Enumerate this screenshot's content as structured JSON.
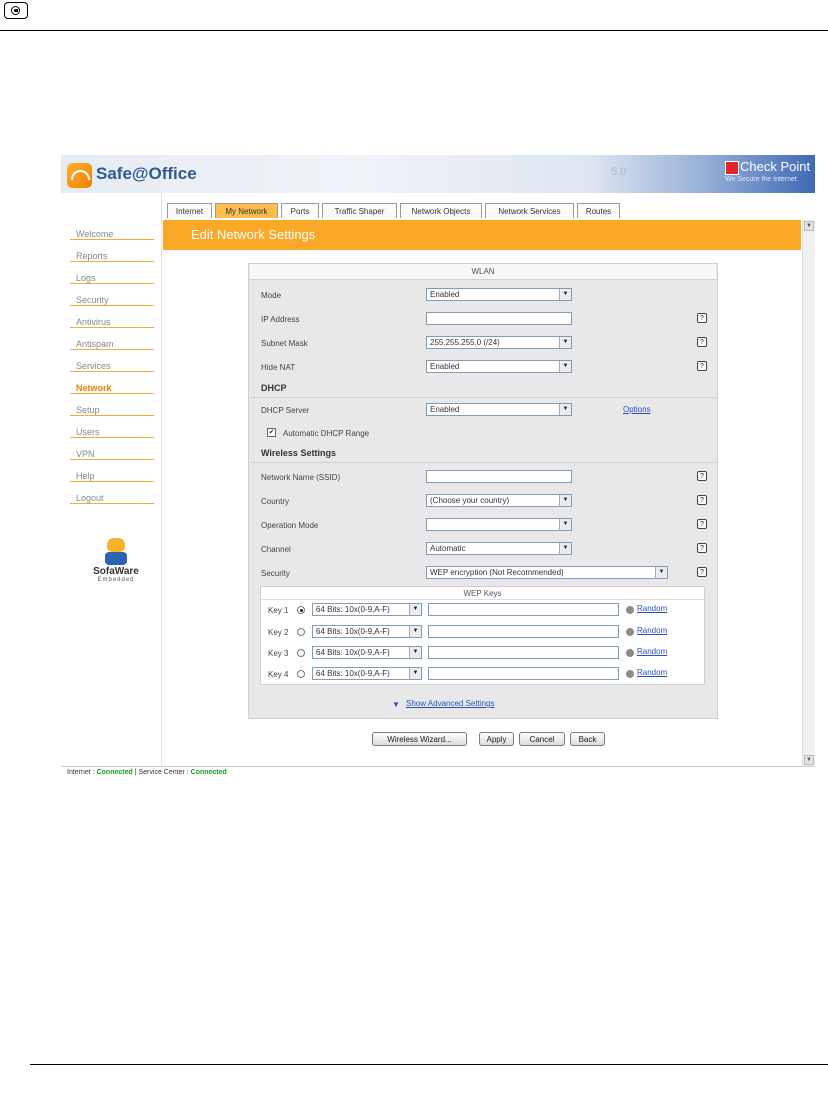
{
  "banner": {
    "brand": "Safe@Office",
    "version": "5.0",
    "vendor": "Check Point",
    "tagline": "We Secure the Internet"
  },
  "sidebar": {
    "items": [
      "Welcome",
      "Reports",
      "Logs",
      "Security",
      "Antivirus",
      "Antispam",
      "Services",
      "Network",
      "Setup",
      "Users",
      "VPN",
      "Help",
      "Logout"
    ],
    "active": "Network",
    "logo_name": "SofaWare",
    "logo_sub": "Embedded"
  },
  "tabs": [
    "Internet",
    "My Network",
    "Ports",
    "Traffic Shaper",
    "Network Objects",
    "Network Services",
    "Routes"
  ],
  "active_tab": "My Network",
  "page_title": "Edit Network Settings",
  "wlan": {
    "section_title": "WLAN",
    "mode_label": "Mode",
    "mode_value": "Enabled",
    "ip_label": "IP Address",
    "ip_value": "",
    "subnet_label": "Subnet Mask",
    "subnet_value": "255.255.255.0 (/24)",
    "hidenat_label": "Hide NAT",
    "hidenat_value": "Enabled"
  },
  "dhcp": {
    "section_title": "DHCP",
    "server_label": "DHCP Server",
    "server_value": "Enabled",
    "options_link": "Options",
    "auto_range_label": "Automatic DHCP Range",
    "auto_range_checked": true
  },
  "wireless": {
    "section_title": "Wireless Settings",
    "ssid_label": "Network Name (SSID)",
    "ssid_value": "",
    "country_label": "Country",
    "country_value": "(Choose your country)",
    "opmode_label": "Operation Mode",
    "opmode_value": "",
    "channel_label": "Channel",
    "channel_value": "Automatic",
    "security_label": "Security",
    "security_value": "WEP encryption (Not Recommended)"
  },
  "wep": {
    "title": "WEP Keys",
    "random_label": "Random",
    "keys": [
      {
        "label": "Key 1",
        "length": "64 Bits: 10x(0-9,A-F)",
        "value": "",
        "selected": true
      },
      {
        "label": "Key 2",
        "length": "64 Bits: 10x(0-9,A-F)",
        "value": "",
        "selected": false
      },
      {
        "label": "Key 3",
        "length": "64 Bits: 10x(0-9,A-F)",
        "value": "",
        "selected": false
      },
      {
        "label": "Key 4",
        "length": "64 Bits: 10x(0-9,A-F)",
        "value": "",
        "selected": false
      }
    ]
  },
  "advanced_link": "Show Advanced Settings",
  "buttons": {
    "wizard": "Wireless Wizard...",
    "apply": "Apply",
    "cancel": "Cancel",
    "back": "Back"
  },
  "status": {
    "internet_label": "Internet :",
    "internet_value": "Connected",
    "separator": "|",
    "service_label": "Service Center :",
    "service_value": "Connected"
  },
  "icons": {
    "help": "?",
    "dropdown": "▼",
    "check": "✔",
    "arrow": "▼"
  },
  "colors": {
    "accent_orange": "#f9a827",
    "link_blue": "#2b4fc0",
    "status_green": "#1a9d1a"
  }
}
